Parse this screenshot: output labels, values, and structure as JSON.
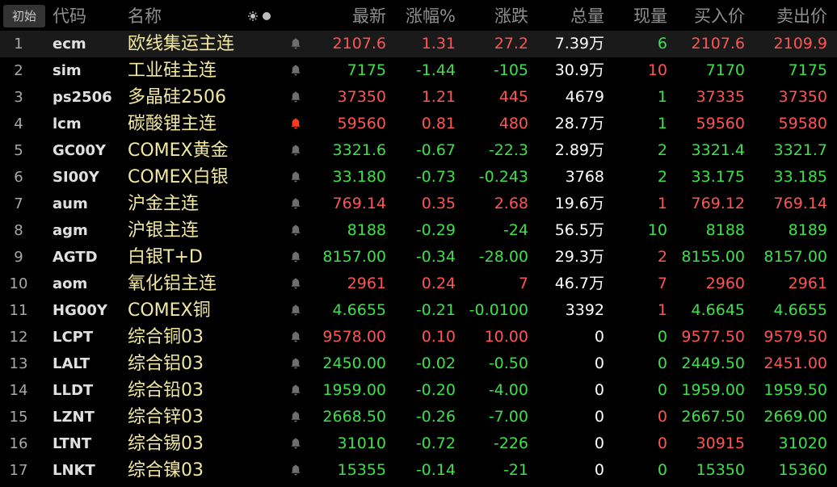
{
  "header": {
    "tab_label": "初始",
    "columns": {
      "code": "代码",
      "name": "名称",
      "last": "最新",
      "pct": "涨幅%",
      "chg": "涨跌",
      "vol": "总量",
      "cur": "现量",
      "bid": "买入价",
      "ask": "卖出价"
    },
    "icons": [
      "settings-sun-icon",
      "dot-icon"
    ]
  },
  "colors": {
    "up": "#ff5454",
    "down": "#3ce04b",
    "flat": "#ffffff",
    "name": "#f2e8a0",
    "bell_active": "#ff3b1f",
    "bell_inactive": "#6e6e6e"
  },
  "rows": [
    {
      "idx": "1",
      "code": "ecm",
      "name": "欧线集运主连",
      "bell": "inactive",
      "last": "2107.6",
      "pct": "1.31",
      "chg": "27.2",
      "vol": "7.39万",
      "cur": "6",
      "bid": "2107.6",
      "ask": "2109.9",
      "dir": "up",
      "cur_dir": "down",
      "bid_dir": "up",
      "ask_dir": "up"
    },
    {
      "idx": "2",
      "code": "sim",
      "name": "工业硅主连",
      "bell": "inactive",
      "last": "7175",
      "pct": "-1.44",
      "chg": "-105",
      "vol": "30.9万",
      "cur": "10",
      "bid": "7170",
      "ask": "7175",
      "dir": "down",
      "cur_dir": "up",
      "bid_dir": "down",
      "ask_dir": "down"
    },
    {
      "idx": "3",
      "code": "ps2506",
      "name": "多晶硅2506",
      "bell": "inactive",
      "last": "37350",
      "pct": "1.21",
      "chg": "445",
      "vol": "4679",
      "cur": "1",
      "bid": "37335",
      "ask": "37350",
      "dir": "up",
      "cur_dir": "down",
      "bid_dir": "up",
      "ask_dir": "up"
    },
    {
      "idx": "4",
      "code": "lcm",
      "name": "碳酸锂主连",
      "bell": "active",
      "last": "59560",
      "pct": "0.81",
      "chg": "480",
      "vol": "28.7万",
      "cur": "1",
      "bid": "59560",
      "ask": "59580",
      "dir": "up",
      "cur_dir": "down",
      "bid_dir": "up",
      "ask_dir": "up"
    },
    {
      "idx": "5",
      "code": "GC00Y",
      "name": "COMEX黄金",
      "bell": "inactive",
      "last": "3321.6",
      "pct": "-0.67",
      "chg": "-22.3",
      "vol": "2.89万",
      "cur": "2",
      "bid": "3321.4",
      "ask": "3321.7",
      "dir": "down",
      "cur_dir": "down",
      "bid_dir": "down",
      "ask_dir": "down"
    },
    {
      "idx": "6",
      "code": "SI00Y",
      "name": "COMEX白银",
      "bell": "inactive",
      "last": "33.180",
      "pct": "-0.73",
      "chg": "-0.243",
      "vol": "3768",
      "cur": "2",
      "bid": "33.175",
      "ask": "33.185",
      "dir": "down",
      "cur_dir": "down",
      "bid_dir": "down",
      "ask_dir": "down"
    },
    {
      "idx": "7",
      "code": "aum",
      "name": "沪金主连",
      "bell": "inactive",
      "last": "769.14",
      "pct": "0.35",
      "chg": "2.68",
      "vol": "19.6万",
      "cur": "1",
      "bid": "769.12",
      "ask": "769.14",
      "dir": "up",
      "cur_dir": "up",
      "bid_dir": "up",
      "ask_dir": "up"
    },
    {
      "idx": "8",
      "code": "agm",
      "name": "沪银主连",
      "bell": "inactive",
      "last": "8188",
      "pct": "-0.29",
      "chg": "-24",
      "vol": "56.5万",
      "cur": "10",
      "bid": "8188",
      "ask": "8189",
      "dir": "down",
      "cur_dir": "down",
      "bid_dir": "down",
      "ask_dir": "down"
    },
    {
      "idx": "9",
      "code": "AGTD",
      "name": "白银T+D",
      "bell": "inactive",
      "last": "8157.00",
      "pct": "-0.34",
      "chg": "-28.00",
      "vol": "29.3万",
      "cur": "2",
      "bid": "8155.00",
      "ask": "8157.00",
      "dir": "down",
      "cur_dir": "up",
      "bid_dir": "down",
      "ask_dir": "down"
    },
    {
      "idx": "10",
      "code": "aom",
      "name": "氧化铝主连",
      "bell": "inactive",
      "last": "2961",
      "pct": "0.24",
      "chg": "7",
      "vol": "46.7万",
      "cur": "7",
      "bid": "2960",
      "ask": "2961",
      "dir": "up",
      "cur_dir": "up",
      "bid_dir": "up",
      "ask_dir": "up"
    },
    {
      "idx": "11",
      "code": "HG00Y",
      "name": "COMEX铜",
      "bell": "inactive",
      "last": "4.6655",
      "pct": "-0.21",
      "chg": "-0.0100",
      "vol": "3392",
      "cur": "1",
      "bid": "4.6645",
      "ask": "4.6655",
      "dir": "down",
      "cur_dir": "up",
      "bid_dir": "down",
      "ask_dir": "down"
    },
    {
      "idx": "12",
      "code": "LCPT",
      "name": "综合铜03",
      "bell": "inactive",
      "last": "9578.00",
      "pct": "0.10",
      "chg": "10.00",
      "vol": "0",
      "cur": "0",
      "bid": "9577.50",
      "ask": "9579.50",
      "dir": "up",
      "cur_dir": "down",
      "bid_dir": "up",
      "ask_dir": "up"
    },
    {
      "idx": "13",
      "code": "LALT",
      "name": "综合铝03",
      "bell": "inactive",
      "last": "2450.00",
      "pct": "-0.02",
      "chg": "-0.50",
      "vol": "0",
      "cur": "0",
      "bid": "2449.50",
      "ask": "2451.00",
      "dir": "down",
      "cur_dir": "down",
      "bid_dir": "down",
      "ask_dir": "up"
    },
    {
      "idx": "14",
      "code": "LLDT",
      "name": "综合铅03",
      "bell": "inactive",
      "last": "1959.00",
      "pct": "-0.20",
      "chg": "-4.00",
      "vol": "0",
      "cur": "0",
      "bid": "1959.00",
      "ask": "1959.50",
      "dir": "down",
      "cur_dir": "down",
      "bid_dir": "down",
      "ask_dir": "down"
    },
    {
      "idx": "15",
      "code": "LZNT",
      "name": "综合锌03",
      "bell": "inactive",
      "last": "2668.50",
      "pct": "-0.26",
      "chg": "-7.00",
      "vol": "0",
      "cur": "0",
      "bid": "2667.50",
      "ask": "2669.00",
      "dir": "down",
      "cur_dir": "up",
      "bid_dir": "down",
      "ask_dir": "down"
    },
    {
      "idx": "16",
      "code": "LTNT",
      "name": "综合锡03",
      "bell": "inactive",
      "last": "31010",
      "pct": "-0.72",
      "chg": "-226",
      "vol": "0",
      "cur": "0",
      "bid": "30915",
      "ask": "31020",
      "dir": "down",
      "cur_dir": "up",
      "bid_dir": "up",
      "ask_dir": "down"
    },
    {
      "idx": "17",
      "code": "LNKT",
      "name": "综合镍03",
      "bell": "inactive",
      "last": "15355",
      "pct": "-0.14",
      "chg": "-21",
      "vol": "0",
      "cur": "0",
      "bid": "15350",
      "ask": "15360",
      "dir": "down",
      "cur_dir": "down",
      "bid_dir": "down",
      "ask_dir": "down"
    }
  ]
}
